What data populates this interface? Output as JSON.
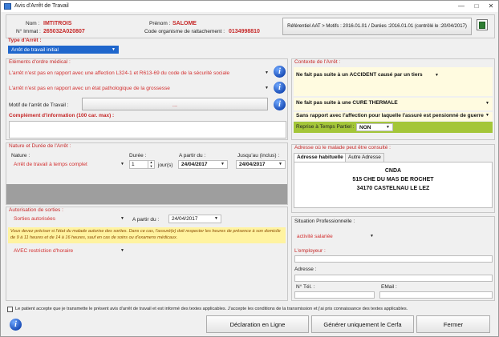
{
  "window": {
    "title": "Avis d'Arrêt de Travail",
    "controls": {
      "minimize": "—",
      "maximize": "□",
      "close": "✕"
    }
  },
  "header": {
    "nom_label": "Nom :",
    "nom_value": "IMTITROIS",
    "immat_label": "N° Immat :",
    "immat_value": "265032A020807",
    "prenom_label": "Prénom :",
    "prenom_value": "SALOME",
    "code_org_label": "Code organisme de rattachement :",
    "code_org_value": "0134998810",
    "referentiel_button": "Référentiel AAT > Motifs : 2016.01.01 / Durées :2016.01.01 (contrôlé le :20/04/2017)"
  },
  "type_arret": {
    "label": "Type d'Arrêt :",
    "value": "Arrêt de travail initial"
  },
  "elements_medicaux": {
    "title": "Eléments d'ordre médical :",
    "affection_value": "L'arrêt n'est pas en rapport avec une affection L324-1 et R613-69 du code de la sécurité sociale",
    "grossesse_value": "L'arrêt n'est pas en rapport avec un état pathologique de la grossesse",
    "motif_label": "Motif de l'arrêt de Travail :",
    "motif_button": "...",
    "complement_label": "Complément d'information (100 car. max) :",
    "complement_value": ""
  },
  "contexte": {
    "title": "Contexte de l'Arrêt :",
    "accident_value": "Ne fait pas suite à un ACCIDENT causé par un tiers",
    "cure_value": "Ne fait pas suite à une CURE THERMALE",
    "pension_value": "Sans rapport avec l'affection pour laquelle l'assuré est pensionné de guerre",
    "reprise_label": "Reprise à Temps Partiel :",
    "reprise_value": "NON"
  },
  "nature_duree": {
    "title": "Nature et Durée de l'Arrêt :",
    "nature_label": "Nature :",
    "nature_value": "Arrêt de travail à temps complet",
    "duree_label": "Durée :",
    "duree_value": "1",
    "duree_unit": "jour(s)",
    "apartir_label": "A partir du :",
    "apartir_value": "24/04/2017",
    "jusquau_label": "Jusqu'au (inclus) :",
    "jusquau_value": "24/04/2017"
  },
  "adresse": {
    "title": "Adresse où le malade peut être consulté :",
    "tab_habituelle": "Adresse habituelle",
    "tab_autre": "Autre Adresse",
    "line1": "CNDA",
    "line2": "515 CHE DU MAS DE ROCHET",
    "line3": "34170 CASTELNAU LE LEZ"
  },
  "sorties": {
    "title": "Autorisation de sorties :",
    "value": "Sorties autorisées",
    "apartir_label": "A partir du :",
    "apartir_value": "24/04/2017",
    "notice": "Vous devez préciser si l'état du malade autorise des sorties. Dans ce cas, l'assuré(e) doit respecter les heures de présence à son domicile de 9 à 11 heures et de 14 à 16 heures, sauf en cas de soins ou d'examens médicaux.",
    "restriction_value": "AVEC restriction d'horaire"
  },
  "situation": {
    "title": "Situation Professionnelle :",
    "value": "activité salariée",
    "employeur_label": "L'employeur :",
    "employeur_value": "",
    "adresse_label": "Adresse :",
    "adresse_value": "",
    "tel_label": "N° Tél. :",
    "tel_value": "",
    "email_label": "EMail :",
    "email_value": ""
  },
  "footer": {
    "consent_text": "Le patient accepte que je transmette le présent avis d'arrêt de travail et est informé des textes applicables. J'accepte les conditions de la transmission et j'ai pris connaissance des textes applicables.",
    "btn_declaration": "Déclaration en Ligne",
    "btn_cerfa": "Générer uniquement le Cerfa",
    "btn_fermer": "Fermer"
  },
  "colors": {
    "accent_red": "#c62828",
    "selection_blue": "#1f66cc",
    "reprise_green": "#a4c639",
    "notice_yellow": "#fff3a0"
  }
}
